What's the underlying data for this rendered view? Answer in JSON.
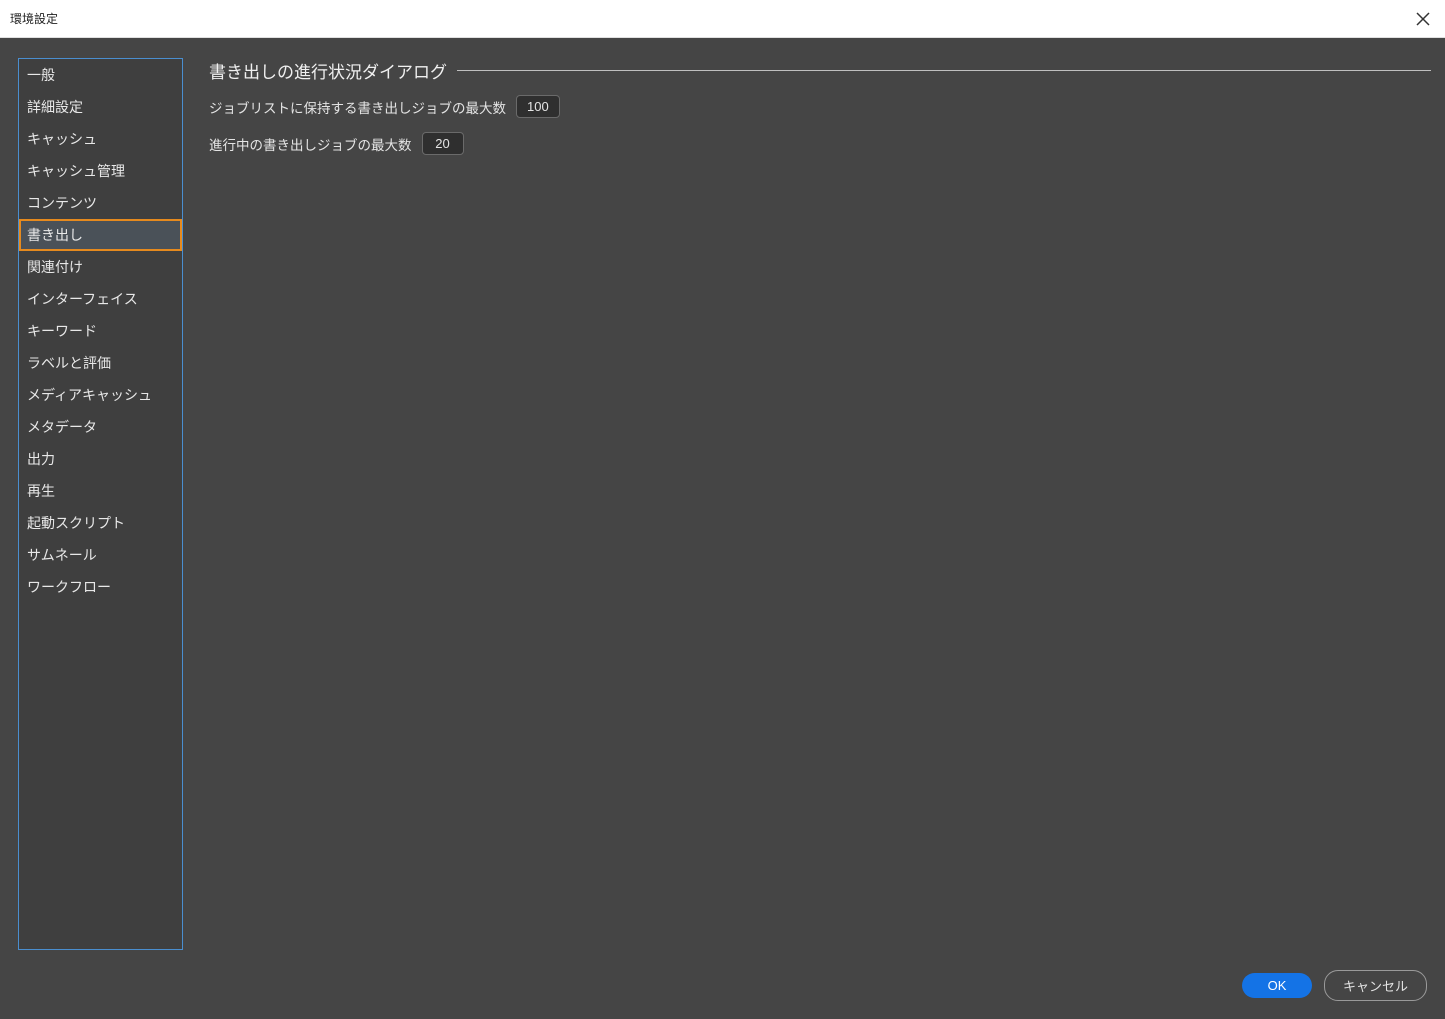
{
  "window": {
    "title": "環境設定"
  },
  "sidebar": {
    "items": [
      {
        "label": "一般"
      },
      {
        "label": "詳細設定"
      },
      {
        "label": "キャッシュ"
      },
      {
        "label": "キャッシュ管理"
      },
      {
        "label": "コンテンツ"
      },
      {
        "label": "書き出し",
        "selected": true
      },
      {
        "label": "関連付け"
      },
      {
        "label": "インターフェイス"
      },
      {
        "label": "キーワード"
      },
      {
        "label": "ラベルと評価"
      },
      {
        "label": "メディアキャッシュ"
      },
      {
        "label": "メタデータ"
      },
      {
        "label": "出力"
      },
      {
        "label": "再生"
      },
      {
        "label": "起動スクリプト"
      },
      {
        "label": "サムネール"
      },
      {
        "label": "ワークフロー"
      }
    ]
  },
  "main": {
    "section_title": "書き出しの進行状況ダイアログ",
    "max_jobs_in_list_label": "ジョブリストに保持する書き出しジョブの最大数",
    "max_jobs_in_list_value": "100",
    "max_concurrent_jobs_label": "進行中の書き出しジョブの最大数",
    "max_concurrent_jobs_value": "20"
  },
  "footer": {
    "ok_label": "OK",
    "cancel_label": "キャンセル"
  }
}
